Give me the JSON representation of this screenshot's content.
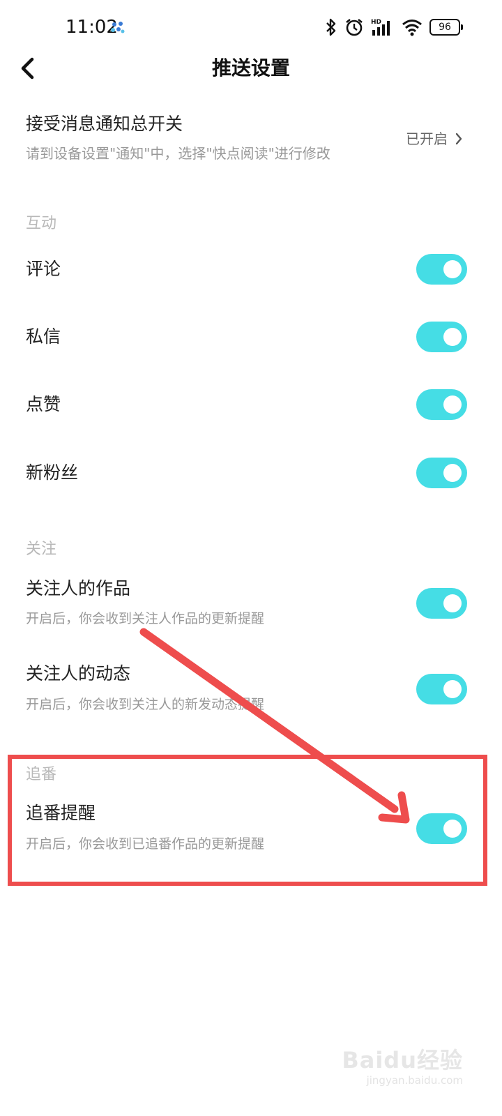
{
  "status_bar": {
    "time": "11:02",
    "battery": "96",
    "icons": [
      "bluetooth-icon",
      "alarm-icon",
      "hd-signal-icon",
      "wifi-icon",
      "battery-icon"
    ]
  },
  "header": {
    "title": "推送设置"
  },
  "master": {
    "title": "接受消息通知总开关",
    "description": "请到设备设置\"通知\"中，选择\"快点阅读\"进行修改",
    "status": "已开启"
  },
  "sections": {
    "interaction": {
      "header": "互动",
      "items": [
        {
          "label": "评论",
          "on": true
        },
        {
          "label": "私信",
          "on": true
        },
        {
          "label": "点赞",
          "on": true
        },
        {
          "label": "新粉丝",
          "on": true
        }
      ]
    },
    "follow": {
      "header": "关注",
      "items": [
        {
          "label": "关注人的作品",
          "description": "开启后，你会收到关注人作品的更新提醒",
          "on": true
        },
        {
          "label": "关注人的动态",
          "description": "开启后，你会收到关注人的新发动态提醒",
          "on": true
        }
      ]
    },
    "anime": {
      "header": "追番",
      "items": [
        {
          "label": "追番提醒",
          "description": "开启后，你会收到已追番作品的更新提醒",
          "on": true
        }
      ]
    }
  },
  "colors": {
    "toggle_on": "#45dde5",
    "annotation_red": "#ee4d4d"
  },
  "watermark": {
    "logo": "Baidu经验",
    "url": "jingyan.baidu.com"
  }
}
